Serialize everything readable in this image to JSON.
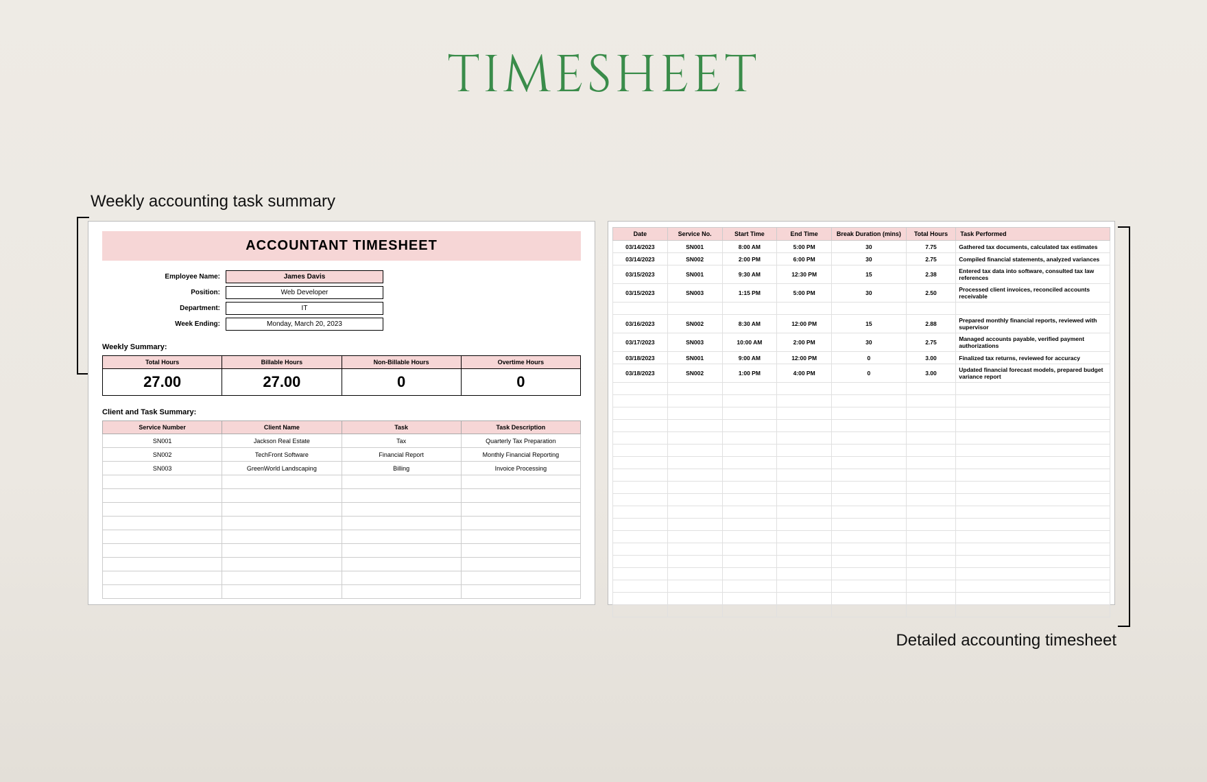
{
  "title": "TIMESHEET",
  "captions": {
    "left": "Weekly accounting task summary",
    "right": "Detailed accounting timesheet"
  },
  "left": {
    "heading": "ACCOUNTANT TIMESHEET",
    "info": {
      "employee_label": "Employee Name:",
      "employee": "James Davis",
      "position_label": "Position:",
      "position": "Web Developer",
      "department_label": "Department:",
      "department": "IT",
      "weekending_label": "Week Ending:",
      "weekending": "Monday, March 20, 2023"
    },
    "weekly_summary_label": "Weekly Summary:",
    "summary_headers": [
      "Total Hours",
      "Billable Hours",
      "Non-Billable Hours",
      "Overtime Hours"
    ],
    "summary_values": [
      "27.00",
      "27.00",
      "0",
      "0"
    ],
    "client_task_label": "Client and Task Summary:",
    "ct_headers": [
      "Service Number",
      "Client Name",
      "Task",
      "Task Description"
    ],
    "ct_rows": [
      [
        "SN001",
        "Jackson Real Estate",
        "Tax",
        "Quarterly Tax Preparation"
      ],
      [
        "SN002",
        "TechFront Software",
        "Financial Report",
        "Monthly Financial Reporting"
      ],
      [
        "SN003",
        "GreenWorld Landscaping",
        "Billing",
        "Invoice Processing"
      ]
    ]
  },
  "right": {
    "headers": [
      "Date",
      "Service No.",
      "Start Time",
      "End Time",
      "Break Duration (mins)",
      "Total Hours",
      "Task Performed"
    ],
    "rows": [
      [
        "03/14/2023",
        "SN001",
        "8:00 AM",
        "5:00 PM",
        "30",
        "7.75",
        "Gathered tax documents, calculated tax estimates"
      ],
      [
        "03/14/2023",
        "SN002",
        "2:00 PM",
        "6:00 PM",
        "30",
        "2.75",
        "Compiled financial statements, analyzed variances"
      ],
      [
        "03/15/2023",
        "SN001",
        "9:30 AM",
        "12:30 PM",
        "15",
        "2.38",
        "Entered tax data into software, consulted tax law references"
      ],
      [
        "03/15/2023",
        "SN003",
        "1:15 PM",
        "5:00 PM",
        "30",
        "2.50",
        "Processed client invoices, reconciled accounts receivable"
      ],
      [],
      [
        "03/16/2023",
        "SN002",
        "8:30 AM",
        "12:00 PM",
        "15",
        "2.88",
        "Prepared monthly financial reports, reviewed with supervisor"
      ],
      [
        "03/17/2023",
        "SN003",
        "10:00 AM",
        "2:00 PM",
        "30",
        "2.75",
        "Managed accounts payable, verified payment authorizations"
      ],
      [
        "03/18/2023",
        "SN001",
        "9:00 AM",
        "12:00 PM",
        "0",
        "3.00",
        "Finalized tax returns, reviewed for accuracy"
      ],
      [
        "03/18/2023",
        "SN002",
        "1:00 PM",
        "4:00 PM",
        "0",
        "3.00",
        "Updated financial forecast models, prepared budget variance report"
      ]
    ]
  }
}
